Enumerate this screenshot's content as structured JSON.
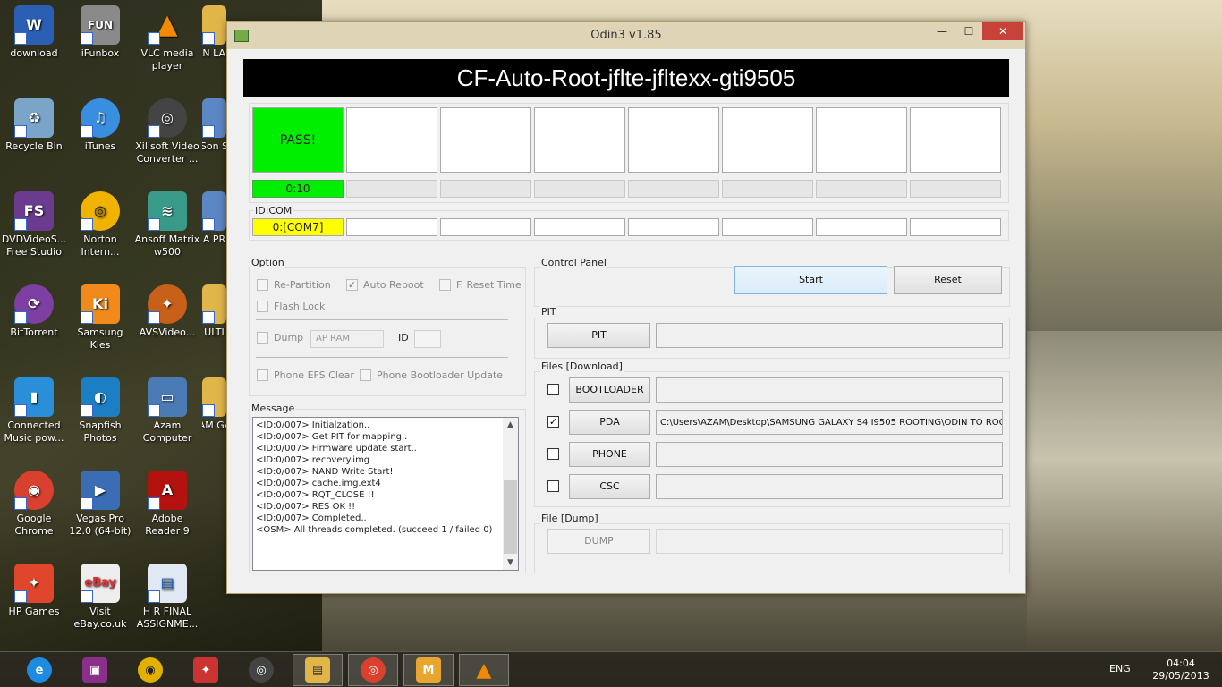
{
  "desktop": {
    "col1": [
      "download",
      "Recycle Bin",
      "DVDVideoS... Free Studio",
      "BitTorrent",
      "Connected Music pow...",
      "Google Chrome",
      "HP Games"
    ],
    "col2": [
      "iFunbox",
      "iTunes",
      "Norton Intern...",
      "Samsung Kies",
      "Snapfish Photos",
      "Vegas Pro 12.0 (64-bit)",
      "Visit eBay.co.uk"
    ],
    "col3": [
      "VLC media player",
      "Xilisoft Video Converter ...",
      "Ansoff Matrix w500",
      "AVSVideo...",
      "Azam Computer",
      "Adobe Reader 9",
      "H R FINAL ASSIGNME..."
    ],
    "col4": [
      "AN LAU",
      "Son S",
      "A PR",
      "ULTI",
      "SAM GAL"
    ],
    "icon_glyphs": {
      "col1": [
        "W",
        "♻",
        "FS",
        "⟳",
        "▮",
        "◉",
        "✦"
      ],
      "col2": [
        "FUN",
        "♫",
        "◎",
        "Ki",
        "◐",
        "▶",
        "eBay"
      ],
      "col3": [
        "▲",
        "◎",
        "≋",
        "✦",
        "▭",
        "A",
        "▤"
      ]
    }
  },
  "window": {
    "title": "Odin3 v1.85",
    "close": "✕",
    "minimize": "—",
    "maximize": "☐",
    "banner": "CF-Auto-Root-jflte-jfltexx-gti9505",
    "status_label": "PASS!",
    "timer": "0:10",
    "idcom_title": "ID:COM",
    "com_port": "0:[COM7]",
    "option": {
      "title": "Option",
      "re_partition": "Re-Partition",
      "auto_reboot": "Auto Reboot",
      "f_reset": "F. Reset Time",
      "flash_lock": "Flash Lock",
      "dump": "Dump",
      "ap_ram": "AP RAM",
      "id_label": "ID",
      "efs_clear": "Phone EFS Clear",
      "bootloader_update": "Phone Bootloader Update",
      "check": "✓"
    },
    "message": {
      "title": "Message",
      "lines": [
        "<ID:0/007> Initialzation..",
        "<ID:0/007> Get PIT for mapping..",
        "<ID:0/007> Firmware update start..",
        "<ID:0/007> recovery.img",
        "<ID:0/007> NAND Write Start!!",
        "<ID:0/007> cache.img.ext4",
        "<ID:0/007> RQT_CLOSE !!",
        "<ID:0/007> RES OK !!",
        "<ID:0/007> Completed..",
        "<OSM> All threads completed. (succeed 1 / failed 0)"
      ],
      "up": "▲",
      "down": "▼"
    },
    "control": {
      "title": "Control Panel",
      "start": "Start",
      "reset": "Reset"
    },
    "pit": {
      "title": "PIT",
      "button": "PIT"
    },
    "files": {
      "title": "Files [Download]",
      "bootloader": "BOOTLOADER",
      "pda": "PDA",
      "pda_path": "C:\\Users\\AZAM\\Desktop\\SAMSUNG GALAXY S4 I9505 ROOTING\\ODIN TO ROO",
      "phone": "PHONE",
      "csc": "CSC",
      "check": "✓"
    },
    "dump": {
      "title": "File [Dump]",
      "button": "DUMP"
    }
  },
  "taskbar": {
    "items": [
      "e",
      "▣",
      "◉",
      "✦",
      "◎",
      "▤",
      "◎",
      "M",
      "▲"
    ],
    "tray": [
      "ENG"
    ],
    "time": "04:04",
    "date": "29/05/2013"
  }
}
